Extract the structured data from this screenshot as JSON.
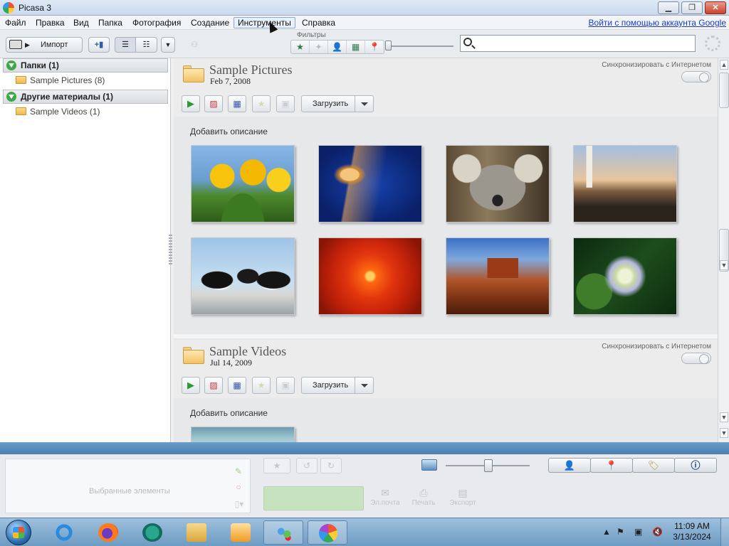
{
  "window": {
    "title": "Picasa 3"
  },
  "menu": {
    "items": [
      "Файл",
      "Правка",
      "Вид",
      "Папка",
      "Фотография",
      "Создание",
      "Инструменты",
      "Справка"
    ],
    "active": "Инструменты",
    "google_link": "Войти с помощью аккаунта Google"
  },
  "toolbar": {
    "import_label": "Импорт",
    "filters_label": "Фильтры",
    "search_placeholder": ""
  },
  "sidebar": {
    "sections": [
      {
        "label": "Папки (1)",
        "items": [
          "Sample Pictures (8)"
        ]
      },
      {
        "label": "Другие материалы (1)",
        "items": [
          "Sample Videos (1)"
        ]
      }
    ]
  },
  "albums": [
    {
      "title": "Sample Pictures",
      "date": "Feb 7, 2008",
      "sync_label": "Синхронизировать с Интернетом",
      "upload_label": "Загрузить",
      "description_prompt": "Добавить описание",
      "photos": [
        "tulips",
        "jellyfish",
        "koala",
        "lighthouse",
        "penguins",
        "chrysanthemum",
        "desert",
        "hydrangeas"
      ]
    },
    {
      "title": "Sample Videos",
      "date": "Jul 14, 2009",
      "sync_label": "Синхронизировать с Интернетом",
      "upload_label": "Загрузить",
      "description_prompt": "Добавить описание",
      "photos": [
        "wildlife-video"
      ]
    }
  ],
  "tray": {
    "selected_label": "Выбранные элементы",
    "actions": [
      "Эл.почта",
      "Печать",
      "Экспорт"
    ]
  },
  "taskbar": {
    "time": "11:09 AM",
    "date": "3/13/2024"
  },
  "colors": {
    "accent_blue": "#4a7fb0",
    "play_green": "#2e9a37",
    "link_blue": "#1a3cc8"
  }
}
